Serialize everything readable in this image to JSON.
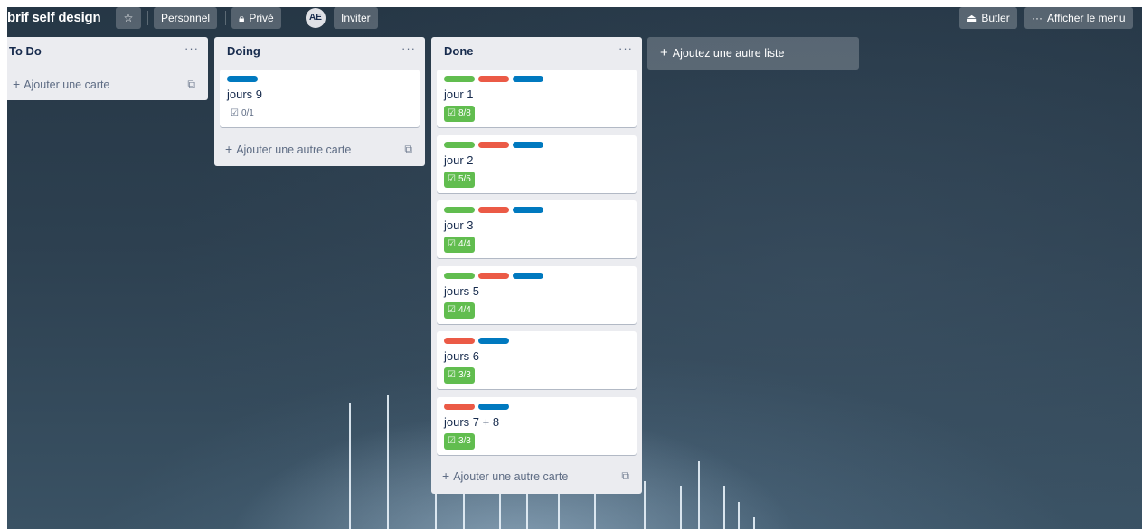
{
  "header": {
    "board_title": "brif self design",
    "star_icon": "star-icon",
    "workspace": "Personnel",
    "visibility_icon": "lock-icon",
    "visibility": "Privé",
    "member_initials": "AE",
    "invite": "Inviter",
    "butler_icon": "butler-icon",
    "butler": "Butler",
    "menu_icon": "ellipsis-icon",
    "show_menu": "Afficher le menu"
  },
  "colors": {
    "label_green": "#61bd4f",
    "label_red": "#eb5a46",
    "label_blue": "#0079bf",
    "list_bg": "#ebecf0"
  },
  "lists": [
    {
      "title": "To Do",
      "menu": "···",
      "cards": [],
      "add_card": "Ajouter une carte"
    },
    {
      "title": "Doing",
      "menu": "···",
      "cards": [
        {
          "labels": [
            "blue"
          ],
          "title": "jours 9",
          "checklist": "0/1",
          "complete": false
        }
      ],
      "add_card": "Ajouter une autre carte"
    },
    {
      "title": "Done",
      "menu": "···",
      "cards": [
        {
          "labels": [
            "green",
            "red",
            "blue"
          ],
          "title": "jour 1",
          "checklist": "8/8",
          "complete": true
        },
        {
          "labels": [
            "green",
            "red",
            "blue"
          ],
          "title": "jour 2",
          "checklist": "5/5",
          "complete": true
        },
        {
          "labels": [
            "green",
            "red",
            "blue"
          ],
          "title": "jour 3",
          "checklist": "4/4",
          "complete": true
        },
        {
          "labels": [
            "green",
            "red",
            "blue"
          ],
          "title": "jours 5",
          "checklist": "4/4",
          "complete": true
        },
        {
          "labels": [
            "red",
            "blue"
          ],
          "title": "jours 6",
          "checklist": "3/3",
          "complete": true
        },
        {
          "labels": [
            "red",
            "blue"
          ],
          "title": "jours 7 + 8",
          "checklist": "3/3",
          "complete": true
        }
      ],
      "add_card": "Ajouter une autre carte"
    }
  ],
  "add_list": "Ajoutez une autre liste"
}
